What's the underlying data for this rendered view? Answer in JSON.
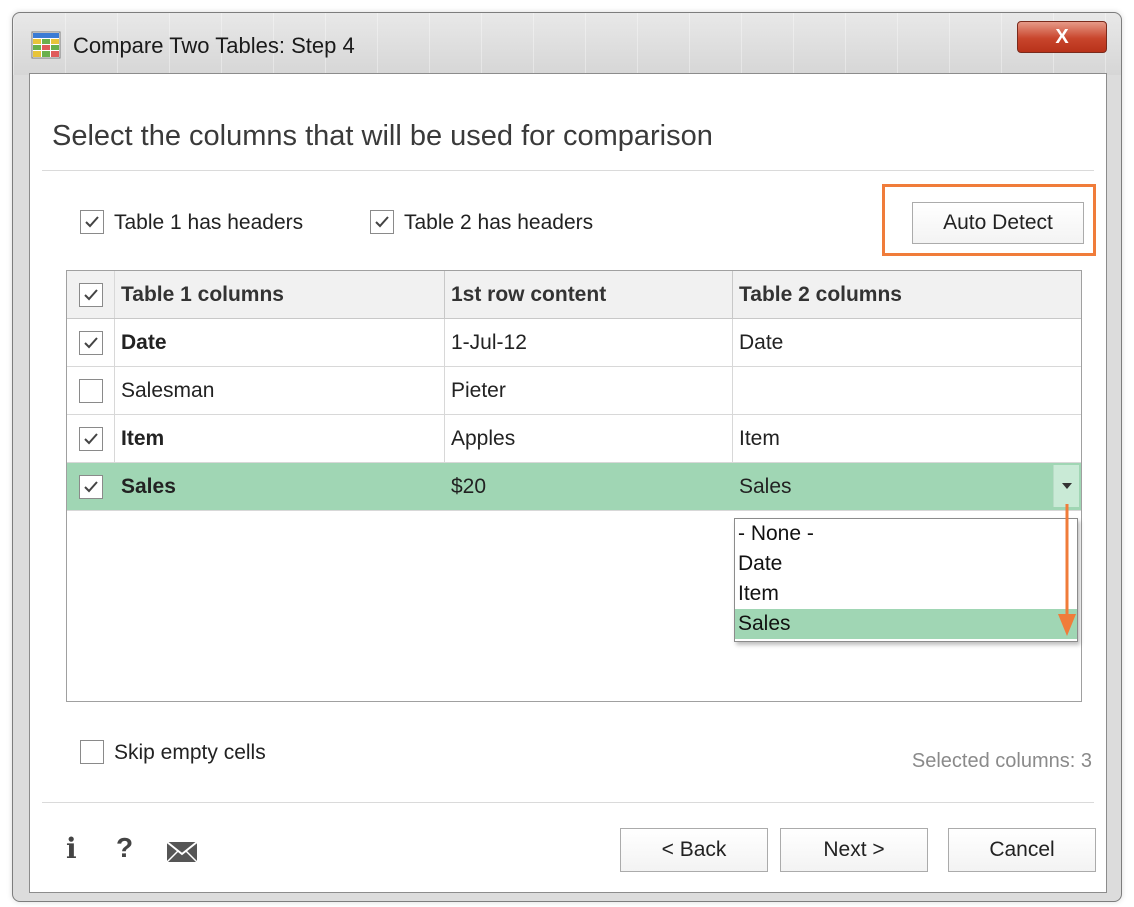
{
  "window": {
    "title": "Compare Two Tables: Step 4",
    "close_label": "X"
  },
  "heading": "Select the columns that will be used for comparison",
  "options": {
    "table1_headers": {
      "label": "Table 1 has headers",
      "checked": true
    },
    "table2_headers": {
      "label": "Table 2 has headers",
      "checked": true
    },
    "auto_detect_label": "Auto Detect"
  },
  "grid": {
    "headers": [
      "Table 1 columns",
      "1st row content",
      "Table 2 columns"
    ],
    "header_checked": true,
    "rows": [
      {
        "checked": true,
        "table1": "Date",
        "content": "1-Jul-12",
        "table2": "Date"
      },
      {
        "checked": false,
        "table1": "Salesman",
        "content": "Pieter",
        "table2": ""
      },
      {
        "checked": true,
        "table1": "Item",
        "content": "Apples",
        "table2": "Item"
      },
      {
        "checked": true,
        "table1": "Sales",
        "content": "$20",
        "table2": "Sales"
      }
    ],
    "selected_row": 3,
    "dropdown_options": [
      "- None -",
      "Date",
      "Item",
      "Sales"
    ],
    "dropdown_selected": "Sales"
  },
  "footer": {
    "skip_empty": {
      "label": "Skip empty cells",
      "checked": false
    },
    "selected_columns": "Selected columns: 3",
    "back_label": "< Back",
    "next_label": "Next >",
    "cancel_label": "Cancel",
    "icons": [
      "info-icon",
      "help-icon",
      "mail-icon"
    ]
  },
  "colors": {
    "selection_green": "#a0d6b4",
    "highlight_orange": "#f07c3a",
    "close_red": "#c8452c"
  }
}
